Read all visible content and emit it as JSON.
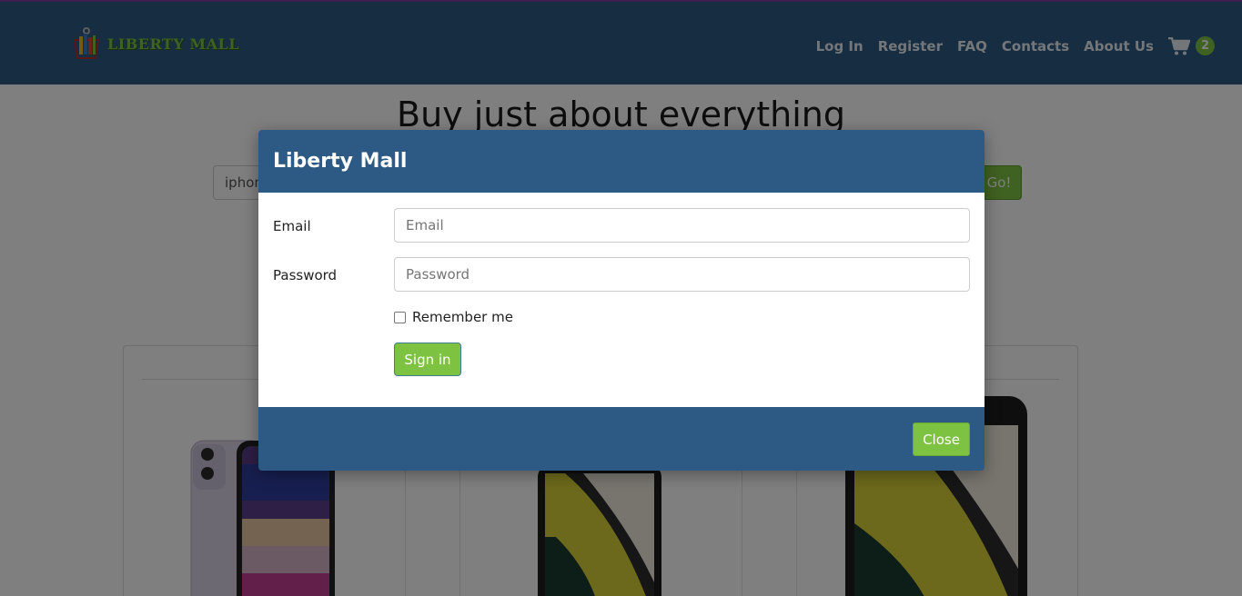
{
  "brand": {
    "name": "LIBERTY MALL"
  },
  "nav": {
    "links": [
      "Log In",
      "Register",
      "FAQ",
      "Contacts",
      "About Us"
    ],
    "cart_count": "2"
  },
  "hero": {
    "title": "Buy just about everything"
  },
  "search": {
    "value": "iphone",
    "button_label": "Go!"
  },
  "modal": {
    "title": "Liberty Mall",
    "email_label": "Email",
    "email_placeholder": "Email",
    "password_label": "Password",
    "password_placeholder": "Password",
    "remember_label": "Remember me",
    "signin_label": "Sign in",
    "close_label": "Close"
  },
  "colors": {
    "navbar": "#2c5a84",
    "accent_green": "#7ec242"
  },
  "icons": [
    "shopping-basket-logo-icon",
    "shopping-cart-icon"
  ]
}
